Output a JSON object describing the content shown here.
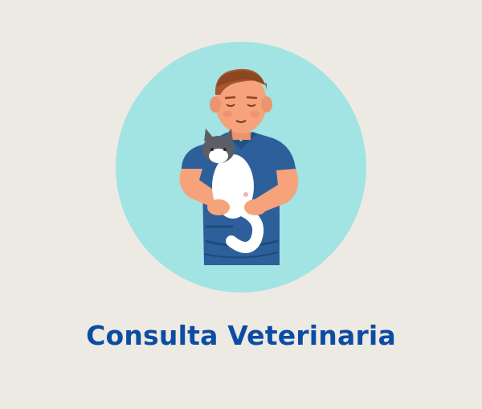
{
  "card": {
    "title": "Consulta Veterinaria",
    "illustration_icon": "veterinarian-holding-cat-icon",
    "colors": {
      "background": "#edeae4",
      "circle": "#a2e3e3",
      "title": "#0c4ca3",
      "scrubs": "#2d609a",
      "skin": "#f6a37c",
      "hair": "#a5572e"
    }
  }
}
